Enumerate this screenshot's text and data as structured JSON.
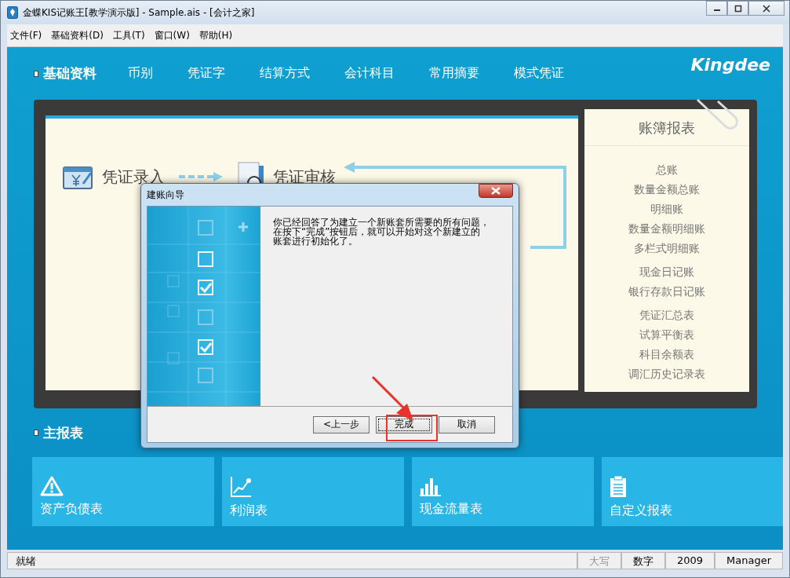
{
  "window": {
    "title": "金蝶KIS记账王[教学演示版] - Sample.ais - [会计之家]"
  },
  "menu": [
    {
      "label": "文件(F)"
    },
    {
      "label": "基础资料(D)"
    },
    {
      "label": "工具(T)"
    },
    {
      "label": "窗口(W)"
    },
    {
      "label": "帮助(H)"
    }
  ],
  "nav": {
    "section": "基础资料",
    "items": [
      "币别",
      "凭证字",
      "结算方式",
      "会计科目",
      "常用摘要",
      "模式凭证"
    ],
    "logo": "Kingdee"
  },
  "flow": [
    {
      "kind": "entry",
      "label": "凭证录入"
    },
    {
      "kind": "review",
      "label": "凭证审核"
    }
  ],
  "ledger_panel": {
    "title": "账簿报表",
    "groups": [
      [
        "总账",
        "数量金额总账",
        "明细账",
        "数量金额明细账",
        "多栏式明细账"
      ],
      [
        "现金日记账",
        "银行存款日记账"
      ],
      [
        "凭证汇总表",
        "试算平衡表",
        "科目余额表",
        "调汇历史记录表"
      ]
    ]
  },
  "dialog": {
    "title": "建账向导",
    "message": [
      "你已经回答了为建立一个新账套所需要的所有问题，",
      "在按下“完成”按钮后，就可以开始对这个新建立的",
      "账套进行初始化了。"
    ],
    "buttons": [
      {
        "label": "<上一步",
        "focused": false
      },
      {
        "label": "完成",
        "focused": true
      },
      {
        "label": "取消",
        "focused": false
      }
    ]
  },
  "reports": {
    "title": "主报表",
    "tiles": [
      {
        "kind": "warning",
        "label": "资产负债表"
      },
      {
        "kind": "line",
        "label": "利润表"
      },
      {
        "kind": "bars",
        "label": "现金流量表"
      },
      {
        "kind": "clipboard",
        "label": "自定义报表"
      }
    ]
  },
  "status_bar": [
    {
      "text": "就绪",
      "disabled": false
    },
    {
      "text": "大写",
      "disabled": true
    },
    {
      "text": "数字",
      "disabled": false
    },
    {
      "text": "2009",
      "disabled": false
    },
    {
      "text": "Manager",
      "disabled": false
    }
  ]
}
